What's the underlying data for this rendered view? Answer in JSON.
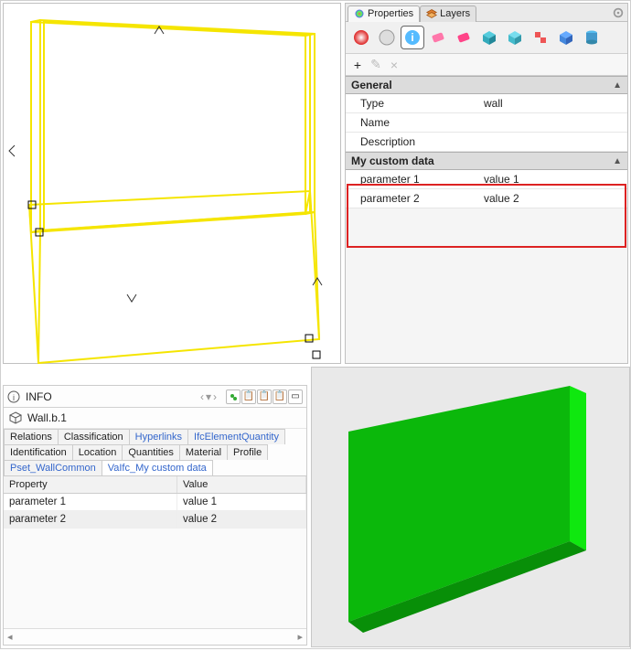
{
  "top_right": {
    "tabs": {
      "properties": "Properties",
      "layers": "Layers"
    },
    "toolbar_icons": [
      "color-sphere-icon",
      "shading-icon",
      "info-icon",
      "eraser-pink-icon",
      "eraser-pink2-icon",
      "cube-cyan-icon",
      "cube-cyan2-icon",
      "cubes-red-icon",
      "cube-blue-icon",
      "cylinder-icon"
    ],
    "sections": {
      "general": {
        "title": "General",
        "rows": [
          {
            "k": "Type",
            "v": "wall"
          },
          {
            "k": "Name",
            "v": ""
          },
          {
            "k": "Description",
            "v": ""
          }
        ]
      },
      "custom": {
        "title": "My custom data",
        "rows": [
          {
            "k": "parameter 1",
            "v": "value 1"
          },
          {
            "k": "parameter 2",
            "v": "value 2"
          }
        ]
      }
    }
  },
  "bottom_left": {
    "info_label": "INFO",
    "object_name": "Wall.b.1",
    "tabs": [
      "Relations",
      "Classification",
      "Hyperlinks",
      "IfcElementQuantity",
      "Identification",
      "Location",
      "Quantities",
      "Material",
      "Profile",
      "Pset_WallCommon",
      "VaIfc_My custom data"
    ],
    "active_tab": "VaIfc_My custom data",
    "linked_tabs": [
      "Hyperlinks",
      "IfcElementQuantity",
      "Pset_WallCommon",
      "VaIfc_My custom data"
    ],
    "table": {
      "headers": [
        "Property",
        "Value"
      ],
      "rows": [
        {
          "p": "parameter 1",
          "v": "value 1"
        },
        {
          "p": "parameter 2",
          "v": "value 2"
        }
      ]
    }
  }
}
